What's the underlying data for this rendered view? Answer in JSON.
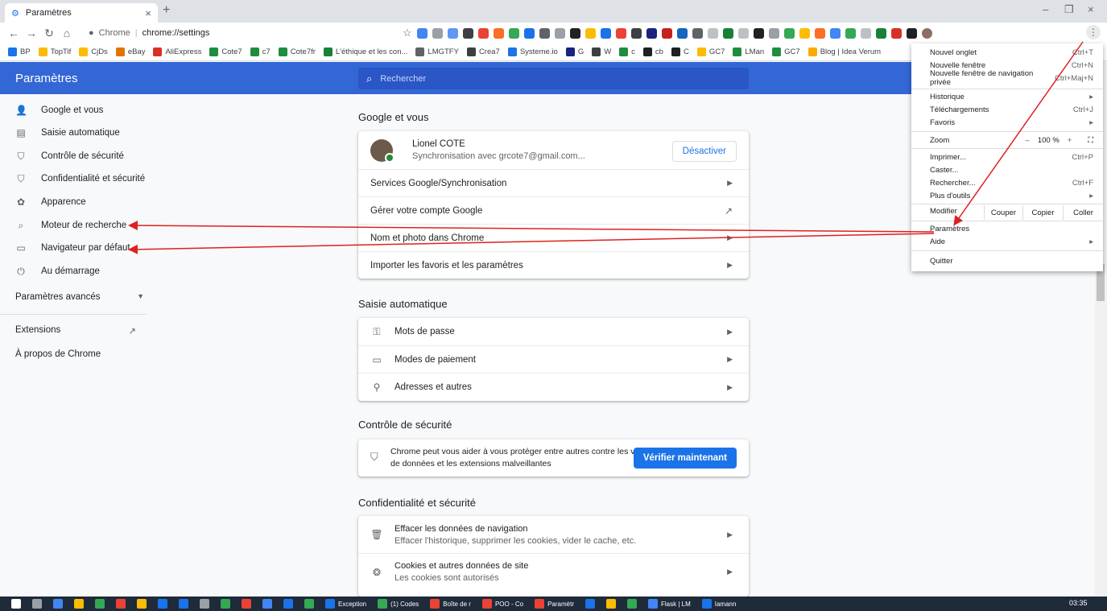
{
  "browser": {
    "tab_title": "Paramètres",
    "tab_close": "×",
    "new_tab": "+",
    "win_min": "–",
    "win_max": "❐",
    "win_close": "×",
    "omnibox_site": "Chrome",
    "omnibox_sep": "|",
    "omnibox_url": "chrome://settings"
  },
  "bookmarks": [
    "BP",
    "TopTif",
    "CjDs",
    "eBay",
    "AliExpress",
    "Cote7",
    "c7",
    "Cote7fr",
    "L'éthique et les con...",
    "LMGTFY",
    "Crea7",
    "Systeme.io",
    "G",
    "W",
    "c",
    "cb",
    "C",
    "GC7",
    "LMan",
    "GC7",
    "Blog | Idea Verum"
  ],
  "header": {
    "title": "Paramètres",
    "search_placeholder": "Rechercher"
  },
  "nav": {
    "items": [
      {
        "label": "Google et vous",
        "icon": "person-icon"
      },
      {
        "label": "Saisie automatique",
        "icon": "clipboard-icon"
      },
      {
        "label": "Contrôle de sécurité",
        "icon": "shield-icon"
      },
      {
        "label": "Confidentialité et sécurité",
        "icon": "privacy-shield-icon"
      },
      {
        "label": "Apparence",
        "icon": "palette-icon"
      },
      {
        "label": "Moteur de recherche",
        "icon": "search-icon"
      },
      {
        "label": "Navigateur par défaut",
        "icon": "browser-icon"
      },
      {
        "label": "Au démarrage",
        "icon": "power-icon"
      }
    ],
    "advanced": "Paramètres avancés",
    "extensions": "Extensions",
    "about": "À propos de Chrome"
  },
  "sections": {
    "google": {
      "title": "Google et vous",
      "user_name": "Lionel COTE",
      "sync_text": "Synchronisation avec grcote7@gmail.com...",
      "disable_button": "Désactiver",
      "rows": [
        "Services Google/Synchronisation",
        "Gérer votre compte Google",
        "Nom et photo dans Chrome",
        "Importer les favoris et les paramètres"
      ]
    },
    "autofill": {
      "title": "Saisie automatique",
      "rows": [
        "Mots de passe",
        "Modes de paiement",
        "Adresses et autres"
      ]
    },
    "safety": {
      "title": "Contrôle de sécurité",
      "text_line1": "Chrome peut vous aider à vous protéger entre autres contre les violations",
      "text_line2": "de données et les extensions malveillantes",
      "button": "Vérifier maintenant"
    },
    "privacy": {
      "title": "Confidentialité et sécurité",
      "rows": [
        {
          "title": "Effacer les données de navigation",
          "sub": "Effacer l'historique, supprimer les cookies, vider le cache, etc."
        },
        {
          "title": "Cookies et autres données de site",
          "sub": "Les cookies sont autorisés"
        }
      ]
    }
  },
  "menu": {
    "new_tab": "Nouvel onglet",
    "new_tab_key": "Ctrl+T",
    "new_window": "Nouvelle fenêtre",
    "new_window_key": "Ctrl+N",
    "incognito": "Nouvelle fenêtre de navigation privée",
    "incognito_key": "Ctrl+Maj+N",
    "history": "Historique",
    "downloads": "Téléchargements",
    "downloads_key": "Ctrl+J",
    "favorites": "Favoris",
    "zoom": "Zoom",
    "zoom_minus": "–",
    "zoom_value": "100 %",
    "zoom_plus": "+",
    "fullscreen": "⛶",
    "print": "Imprimer...",
    "print_key": "Ctrl+P",
    "cast": "Caster...",
    "find": "Rechercher...",
    "find_key": "Ctrl+F",
    "more_tools": "Plus d'outils",
    "edit": "Modifier",
    "cut": "Couper",
    "copy": "Copier",
    "paste": "Coller",
    "settings": "Paramètres",
    "help": "Aide",
    "quit": "Quitter"
  },
  "taskbar": {
    "windows": [
      "Exception",
      "(1) Codes",
      "Boîte de r",
      "POO - Co",
      "Paramètr",
      "Flask | LM",
      "Iamann"
    ],
    "clock": "03:35"
  },
  "colors": {
    "header_blue": "#3367d6",
    "accent": "#1a73e8",
    "arrow": "#e02020"
  }
}
